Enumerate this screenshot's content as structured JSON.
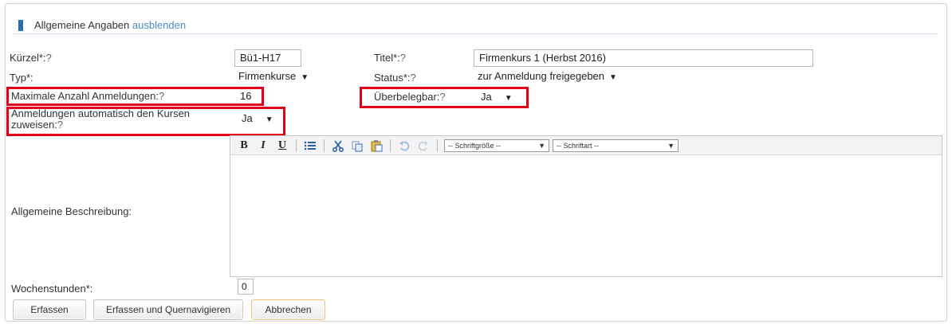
{
  "section": {
    "title": "Allgemeine Angaben",
    "toggle": "ausblenden"
  },
  "fields": {
    "kuerzel_label": "Kürzel*:",
    "kuerzel_q": "?",
    "kuerzel_value": "Bü1-H17",
    "titel_label": "Titel*:",
    "titel_q": "?",
    "titel_value": "Firmenkurs 1 (Herbst 2016)",
    "typ_label": "Typ*:",
    "typ_value": "Firmenkurse",
    "status_label": "Status*:",
    "status_q": "?",
    "status_value": "zur Anmeldung freigegeben",
    "max_label": "Maximale Anzahl Anmeldungen:",
    "max_q": "?",
    "max_value": "16",
    "ueberbelegbar_label": "Überbelegbar:",
    "ueberbelegbar_q": "?",
    "ueberbelegbar_value": "Ja",
    "zuweisen_label_1": "Anmeldungen automatisch den Kursen",
    "zuweisen_label_2": "zuweisen:",
    "zuweisen_q": "?",
    "zuweisen_value": "Ja",
    "beschreibung_label": "Allgemeine Beschreibung:",
    "wochenstunden_label": "Wochenstunden*:",
    "wochenstunden_value": "0"
  },
  "editor": {
    "bold": "B",
    "italic": "I",
    "underline": "U",
    "fontsize_select": "-- Schriftgröße --",
    "fontfamily_select": "-- Schriftart --"
  },
  "buttons": {
    "erfassen": "Erfassen",
    "erfassen_quer": "Erfassen und Quernavigieren",
    "abbrechen": "Abbrechen"
  },
  "colors": {
    "accent": "#2a6db5",
    "link": "#4a8bc9",
    "highlight": "#e3001b"
  }
}
